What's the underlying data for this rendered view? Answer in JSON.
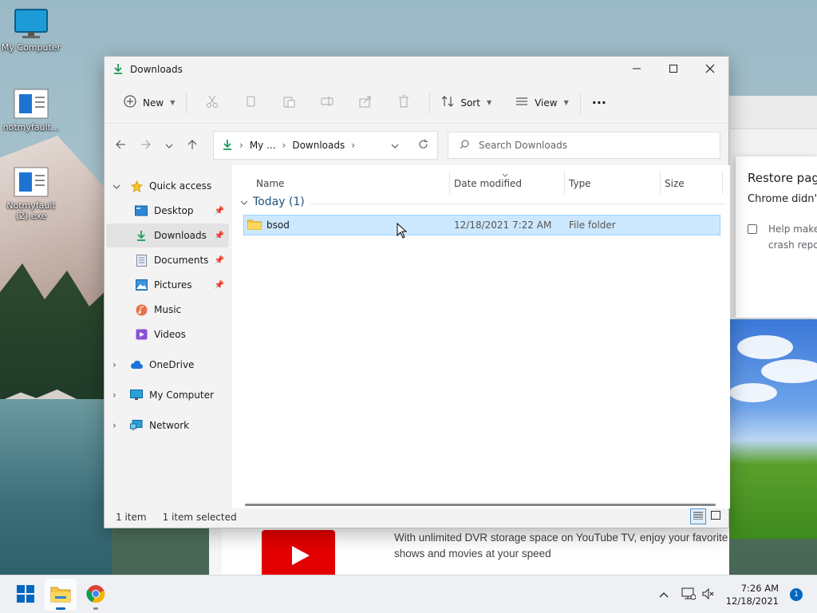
{
  "desktop": {
    "icons": [
      {
        "label": "My Computer",
        "icon": "monitor-icon"
      },
      {
        "label": "notmyfault...",
        "icon": "exe-window-icon"
      },
      {
        "label": "Notmyfault (2).exe",
        "icon": "exe-window-icon"
      }
    ]
  },
  "chrome": {
    "restore_title": "Restore page",
    "restore_subtitle": "Chrome didn't s",
    "checkbox_label_line1": "Help make",
    "checkbox_label_line2": "crash repor"
  },
  "youtube_ad": {
    "text": "With unlimited DVR storage space on YouTube TV, enjoy your favorite shows and movies at your speed"
  },
  "explorer": {
    "title": "Downloads",
    "toolbar": {
      "new_label": "New",
      "sort_label": "Sort",
      "view_label": "View",
      "more_label": "···"
    },
    "address": {
      "crumb1": "My ...",
      "crumb2": "Downloads"
    },
    "search": {
      "placeholder": "Search Downloads"
    },
    "sidebar": {
      "quick_access": "Quick access",
      "items": [
        {
          "label": "Desktop",
          "icon": "desktop-icon"
        },
        {
          "label": "Downloads",
          "icon": "download-icon"
        },
        {
          "label": "Documents",
          "icon": "document-icon"
        },
        {
          "label": "Pictures",
          "icon": "pictures-icon"
        },
        {
          "label": "Music",
          "icon": "music-icon"
        },
        {
          "label": "Videos",
          "icon": "videos-icon"
        }
      ],
      "onedrive": "OneDrive",
      "my_computer": "My Computer",
      "network": "Network"
    },
    "columns": {
      "name": "Name",
      "date": "Date modified",
      "type": "Type",
      "size": "Size"
    },
    "group_label": "Today (1)",
    "files": [
      {
        "name": "bsod",
        "date": "12/18/2021 7:22 AM",
        "type": "File folder",
        "size": ""
      }
    ],
    "status": {
      "count": "1 item",
      "selected": "1 item selected"
    }
  },
  "taskbar": {
    "time": "7:26 AM",
    "date": "12/18/2021",
    "notifications": "1"
  },
  "colors": {
    "accent": "#0067c0",
    "selection": "#cce8ff",
    "download_green": "#1a9e5a"
  }
}
